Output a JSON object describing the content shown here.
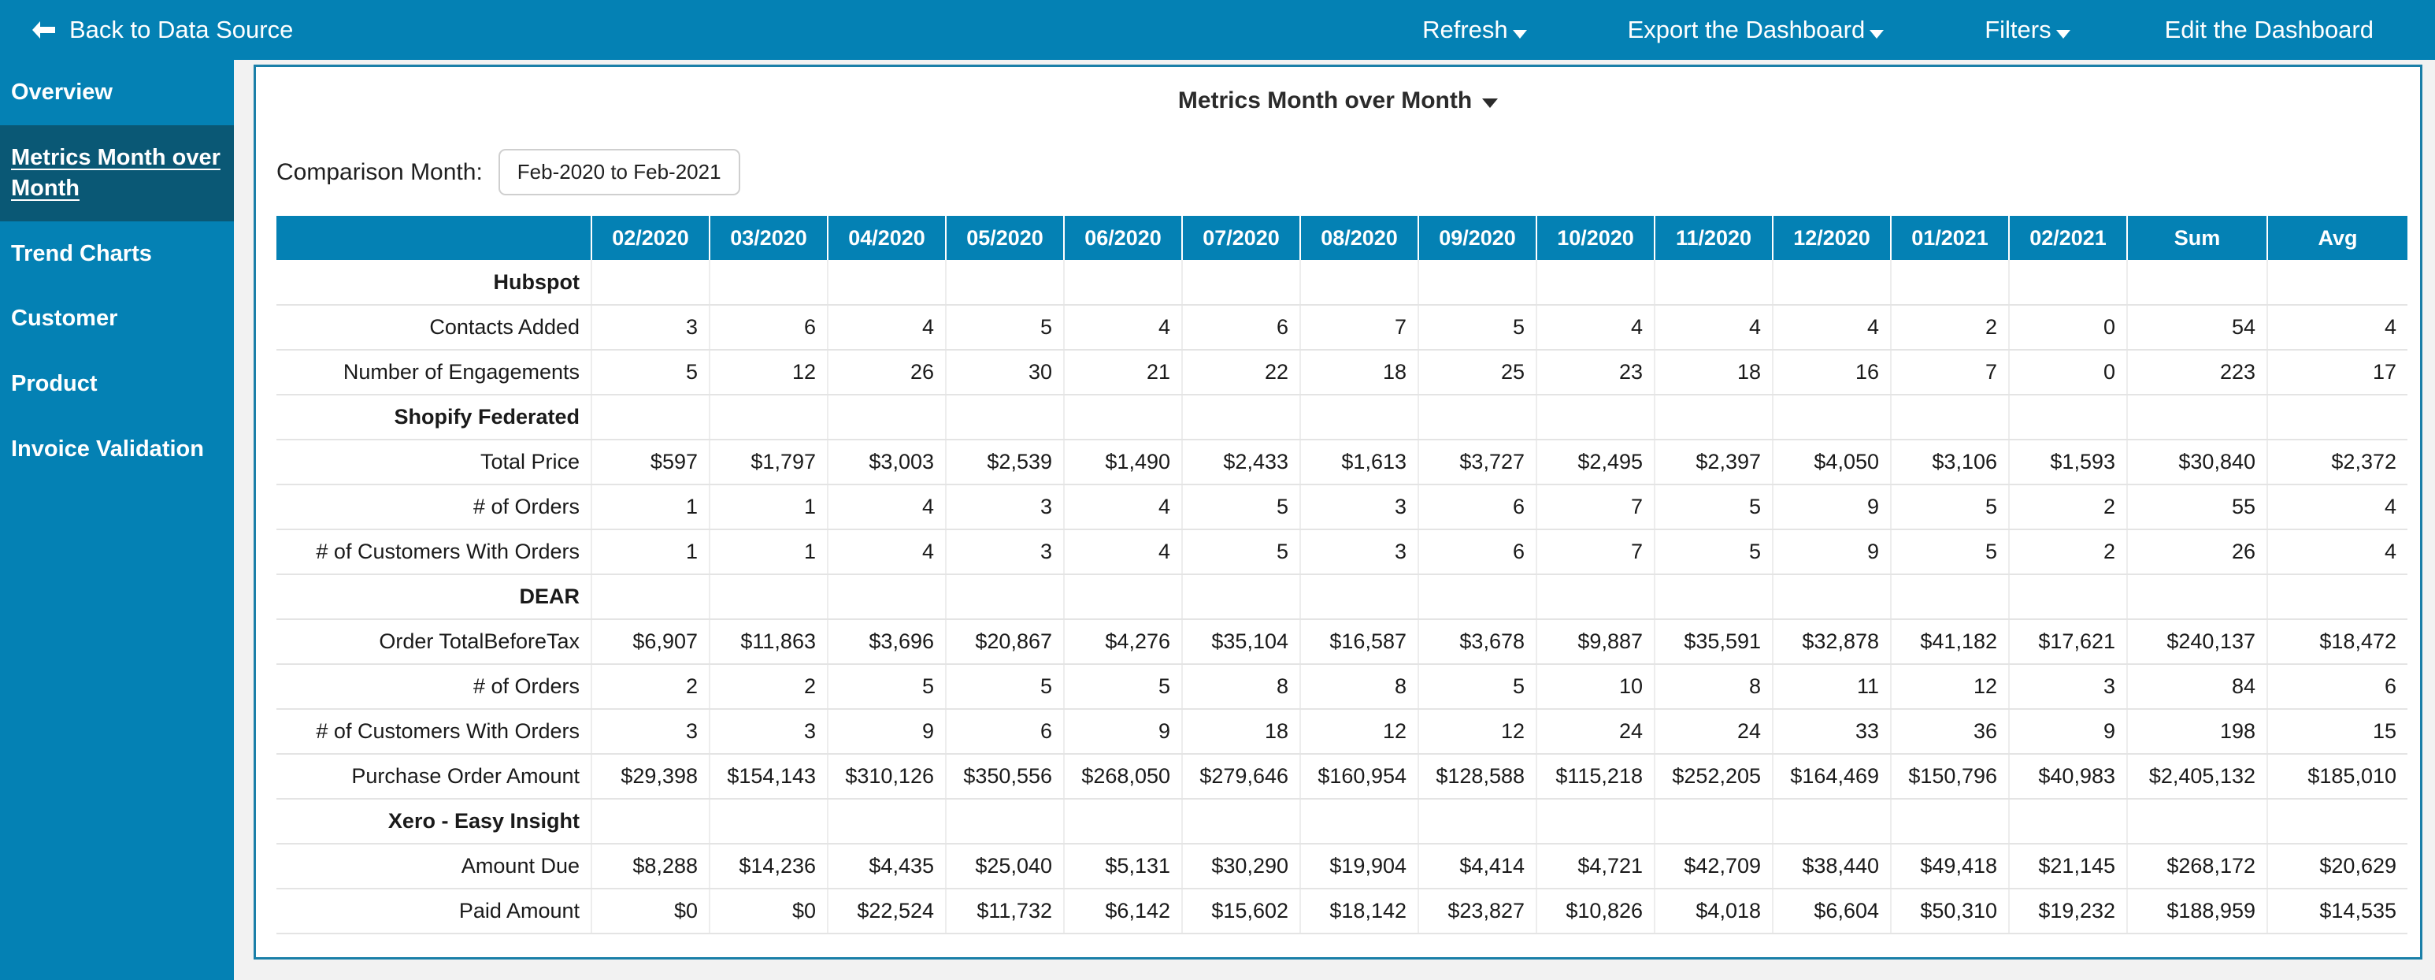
{
  "topbar": {
    "back_label": "Back to Data Source",
    "back_icon": "arrow-left-icon",
    "nav": [
      {
        "label": "Refresh",
        "has_caret": true
      },
      {
        "label": "Export the Dashboard",
        "has_caret": true
      },
      {
        "label": "Filters",
        "has_caret": true
      },
      {
        "label": "Edit the Dashboard",
        "has_caret": false
      }
    ]
  },
  "sidebar": {
    "items": [
      {
        "label": "Overview",
        "active": false
      },
      {
        "label": "Metrics Month over Month",
        "active": true
      },
      {
        "label": "Trend Charts",
        "active": false
      },
      {
        "label": "Customer",
        "active": false
      },
      {
        "label": "Product",
        "active": false
      },
      {
        "label": "Invoice Validation",
        "active": false
      }
    ]
  },
  "panel": {
    "title": "Metrics Month over Month",
    "title_caret_icon": "chevron-down-icon",
    "comparison_label": "Comparison Month:",
    "comparison_value": "Feb-2020 to Feb-2021"
  },
  "colors": {
    "brand_blue": "#0481b4",
    "sidebar_active": "#0a5875",
    "panel_border": "#1a7fa8",
    "page_background": "#f2f2f2",
    "grid_line": "#e4e4e4"
  },
  "chart_data": {
    "type": "table",
    "title": "Metrics Month over Month",
    "columns": [
      "",
      "02/2020",
      "03/2020",
      "04/2020",
      "05/2020",
      "06/2020",
      "07/2020",
      "08/2020",
      "09/2020",
      "10/2020",
      "11/2020",
      "12/2020",
      "01/2021",
      "02/2021",
      "Sum",
      "Avg"
    ],
    "groups": [
      {
        "name": "Hubspot",
        "rows": [
          {
            "label": "Contacts Added",
            "values": [
              "3",
              "6",
              "4",
              "5",
              "4",
              "6",
              "7",
              "5",
              "4",
              "4",
              "4",
              "2",
              "0",
              "54",
              "4"
            ]
          },
          {
            "label": "Number of Engagements",
            "values": [
              "5",
              "12",
              "26",
              "30",
              "21",
              "22",
              "18",
              "25",
              "23",
              "18",
              "16",
              "7",
              "0",
              "223",
              "17"
            ]
          }
        ]
      },
      {
        "name": "Shopify Federated",
        "rows": [
          {
            "label": "Total Price",
            "values": [
              "$597",
              "$1,797",
              "$3,003",
              "$2,539",
              "$1,490",
              "$2,433",
              "$1,613",
              "$3,727",
              "$2,495",
              "$2,397",
              "$4,050",
              "$3,106",
              "$1,593",
              "$30,840",
              "$2,372"
            ]
          },
          {
            "label": "# of Orders",
            "values": [
              "1",
              "1",
              "4",
              "3",
              "4",
              "5",
              "3",
              "6",
              "7",
              "5",
              "9",
              "5",
              "2",
              "55",
              "4"
            ]
          },
          {
            "label": "# of Customers With Orders",
            "values": [
              "1",
              "1",
              "4",
              "3",
              "4",
              "5",
              "3",
              "6",
              "7",
              "5",
              "9",
              "5",
              "2",
              "26",
              "4"
            ]
          }
        ]
      },
      {
        "name": "DEAR",
        "rows": [
          {
            "label": "Order TotalBeforeTax",
            "values": [
              "$6,907",
              "$11,863",
              "$3,696",
              "$20,867",
              "$4,276",
              "$35,104",
              "$16,587",
              "$3,678",
              "$9,887",
              "$35,591",
              "$32,878",
              "$41,182",
              "$17,621",
              "$240,137",
              "$18,472"
            ]
          },
          {
            "label": "# of Orders",
            "values": [
              "2",
              "2",
              "5",
              "5",
              "5",
              "8",
              "8",
              "5",
              "10",
              "8",
              "11",
              "12",
              "3",
              "84",
              "6"
            ]
          },
          {
            "label": "# of Customers With Orders",
            "values": [
              "3",
              "3",
              "9",
              "6",
              "9",
              "18",
              "12",
              "12",
              "24",
              "24",
              "33",
              "36",
              "9",
              "198",
              "15"
            ]
          },
          {
            "label": "Purchase Order Amount",
            "values": [
              "$29,398",
              "$154,143",
              "$310,126",
              "$350,556",
              "$268,050",
              "$279,646",
              "$160,954",
              "$128,588",
              "$115,218",
              "$252,205",
              "$164,469",
              "$150,796",
              "$40,983",
              "$2,405,132",
              "$185,010"
            ]
          }
        ]
      },
      {
        "name": "Xero - Easy Insight",
        "rows": [
          {
            "label": "Amount Due",
            "values": [
              "$8,288",
              "$14,236",
              "$4,435",
              "$25,040",
              "$5,131",
              "$30,290",
              "$19,904",
              "$4,414",
              "$4,721",
              "$42,709",
              "$38,440",
              "$49,418",
              "$21,145",
              "$268,172",
              "$20,629"
            ]
          },
          {
            "label": "Paid Amount",
            "values": [
              "$0",
              "$0",
              "$22,524",
              "$11,732",
              "$6,142",
              "$15,602",
              "$18,142",
              "$23,827",
              "$10,826",
              "$4,018",
              "$6,604",
              "$50,310",
              "$19,232",
              "$188,959",
              "$14,535"
            ]
          }
        ]
      }
    ]
  }
}
